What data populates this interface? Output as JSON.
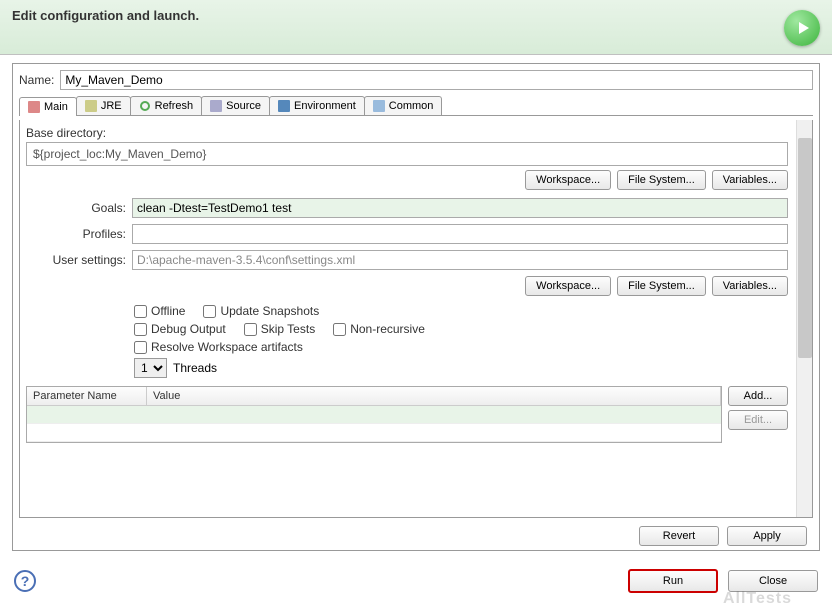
{
  "header": {
    "title": "Edit configuration and launch."
  },
  "name": {
    "label": "Name:",
    "value": "My_Maven_Demo"
  },
  "tabs": {
    "main": "Main",
    "jre": "JRE",
    "refresh": "Refresh",
    "source": "Source",
    "environment": "Environment",
    "common": "Common"
  },
  "main": {
    "base_dir_label": "Base directory:",
    "base_dir_value": "${project_loc:My_Maven_Demo}",
    "workspace_btn": "Workspace...",
    "filesystem_btn": "File System...",
    "variables_btn": "Variables...",
    "goals_label": "Goals:",
    "goals_value": "clean -Dtest=TestDemo1 test",
    "profiles_label": "Profiles:",
    "profiles_value": "",
    "user_settings_label": "User settings:",
    "user_settings_value": "D:\\apache-maven-3.5.4\\conf\\settings.xml",
    "checks": {
      "offline": "Offline",
      "update_snapshots": "Update Snapshots",
      "debug_output": "Debug Output",
      "skip_tests": "Skip Tests",
      "non_recursive": "Non-recursive",
      "resolve_workspace": "Resolve Workspace artifacts"
    },
    "threads": {
      "value": "1",
      "label": "Threads"
    },
    "param_table": {
      "col_name": "Parameter Name",
      "col_value": "Value"
    },
    "add_btn": "Add...",
    "edit_btn": "Edit..."
  },
  "buttons": {
    "revert": "Revert",
    "apply": "Apply",
    "run": "Run",
    "close": "Close"
  },
  "watermark": "AllTests"
}
